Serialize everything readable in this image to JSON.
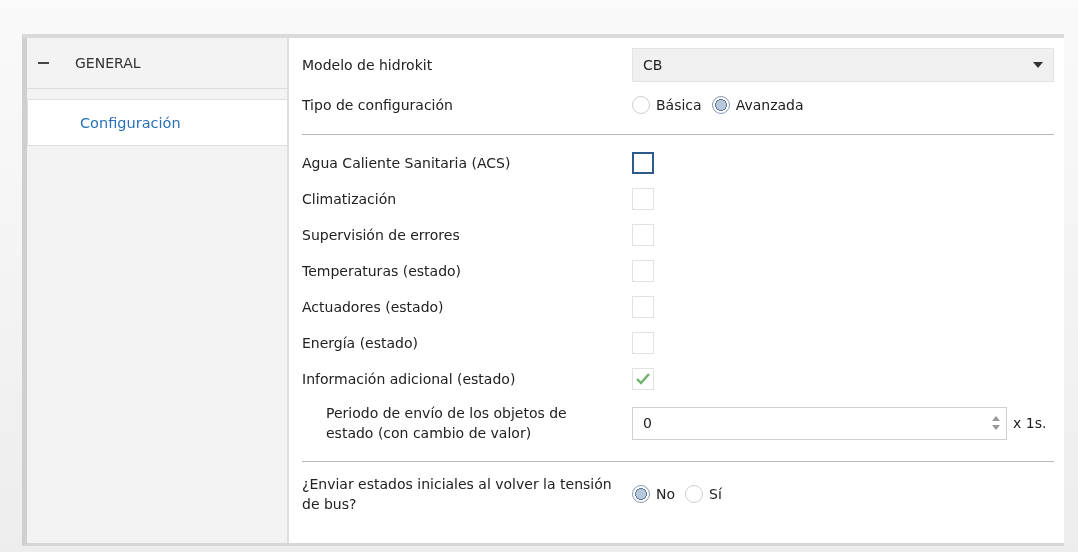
{
  "sidebar": {
    "group": {
      "label": "GENERAL",
      "expanded": true,
      "items": [
        {
          "label": "Configuración",
          "selected": true
        }
      ]
    }
  },
  "form": {
    "model": {
      "label": "Modelo de hidrokit",
      "value": "CB"
    },
    "config_type": {
      "label": "Tipo de configuración",
      "options": [
        {
          "label": "Básica",
          "selected": false
        },
        {
          "label": "Avanzada",
          "selected": true
        }
      ]
    },
    "checks": [
      {
        "label": "Agua Caliente Sanitaria (ACS)",
        "checked": false,
        "kind": "focused"
      },
      {
        "label": "Climatización",
        "checked": false,
        "kind": "plain"
      },
      {
        "label": "Supervisión de errores",
        "checked": false,
        "kind": "plain"
      },
      {
        "label": "Temperaturas (estado)",
        "checked": false,
        "kind": "plain"
      },
      {
        "label": "Actuadores (estado)",
        "checked": false,
        "kind": "plain"
      },
      {
        "label": "Energía (estado)",
        "checked": false,
        "kind": "plain"
      },
      {
        "label": "Información adicional (estado)",
        "checked": true,
        "kind": "plain"
      }
    ],
    "period": {
      "label": "Periodo de envío de los objetos de estado (con cambio de valor)",
      "value": "0",
      "unit": "x 1s."
    },
    "initial": {
      "label": "¿Enviar estados iniciales al volver la tensión de bus?",
      "options": [
        {
          "label": "No",
          "selected": true
        },
        {
          "label": "Sí",
          "selected": false
        }
      ]
    }
  }
}
